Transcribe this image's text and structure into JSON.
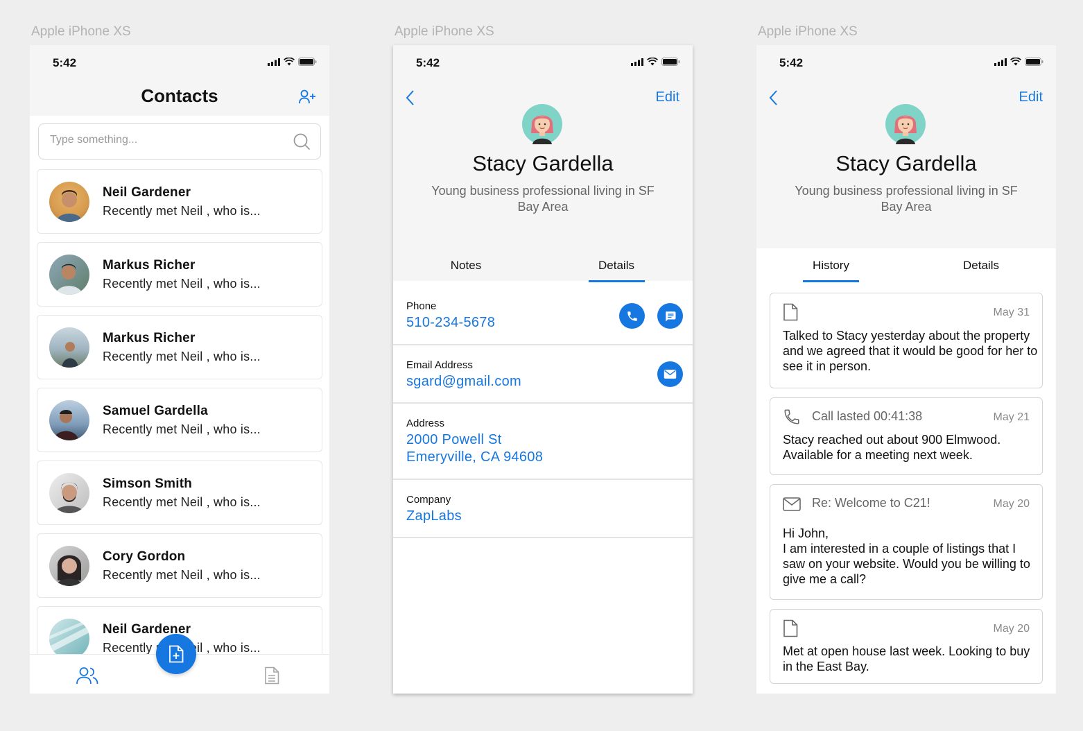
{
  "device_label": "Apple iPhone XS",
  "status_time": "5:42",
  "contacts_screen": {
    "title": "Contacts",
    "search_placeholder": "Type something...",
    "contacts": [
      {
        "name": "Neil Gardener",
        "note": "Recently met Neil , who is..."
      },
      {
        "name": "Markus Richer",
        "note": "Recently met Neil , who is..."
      },
      {
        "name": "Markus Richer",
        "note": "Recently met Neil , who is..."
      },
      {
        "name": "Samuel Gardella",
        "note": "Recently met Neil , who is..."
      },
      {
        "name": "Simson Smith",
        "note": "Recently met Neil , who is..."
      },
      {
        "name": "Cory Gordon",
        "note": "Recently met Neil , who is..."
      },
      {
        "name": "Neil Gardener",
        "note": "Recently met Neil , who is..."
      }
    ]
  },
  "profile": {
    "edit_label": "Edit",
    "name": "Stacy Gardella",
    "description": "Young business professional living in SF Bay Area"
  },
  "details_screen": {
    "tabs": [
      "Notes",
      "Details"
    ],
    "active_tab": "Details",
    "rows": [
      {
        "label": "Phone",
        "value": "510-234-5678"
      },
      {
        "label": "Email Address",
        "value": "sgard@gmail.com"
      },
      {
        "label": "Address",
        "value_line1": "2000 Powell St",
        "value_line2": "Emeryville, CA 94608"
      },
      {
        "label": "Company",
        "value": "ZapLabs"
      }
    ]
  },
  "history_screen": {
    "tabs": [
      "History",
      "Details"
    ],
    "active_tab": "History",
    "entries": [
      {
        "icon": "document-icon",
        "title": "",
        "date": "May 31",
        "text": "Talked to Stacy yesterday about the property and we agreed that it would be good for her to see it in person."
      },
      {
        "icon": "phone-icon",
        "title": "Call lasted 00:41:38",
        "date": "May 21",
        "text": "Stacy reached out about 900 Elmwood. Available for a meeting next week."
      },
      {
        "icon": "mail-icon",
        "title": "Re: Welcome to C21!",
        "date": "May 20",
        "text": "Hi John,\nI am interested in a couple of listings that I saw on your website. Would you be willing to give me a call?"
      },
      {
        "icon": "document-icon",
        "title": "",
        "date": "May 20",
        "text": "Met at open house last week. Looking to buy in the East Bay."
      }
    ]
  },
  "colors": {
    "accent": "#1777e0",
    "header_bg": "#f5f5f5",
    "page_bg": "#eeeeee"
  }
}
